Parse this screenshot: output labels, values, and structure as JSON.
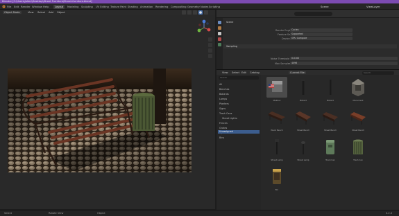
{
  "window": {
    "title": "Blender [C:\\Users\\Julien\\Desktop\\Street Furniture\\Street-furniture.blend]"
  },
  "menu": {
    "items": [
      "File",
      "Edit",
      "Render",
      "Window",
      "Help"
    ],
    "workspaces": [
      "Layout",
      "Modeling",
      "Sculpting",
      "UV Editing",
      "Texture Paint",
      "Shading",
      "Animation",
      "Rendering",
      "Compositing",
      "Geometry Nodes",
      "Scripting"
    ],
    "active_workspace": "Layout",
    "scene_label": "Scene",
    "viewlayer_label": "ViewLayer"
  },
  "viewport_header": {
    "mode": "Object Mode",
    "items": [
      "View",
      "Select",
      "Add",
      "Object"
    ]
  },
  "properties": {
    "section": "Scene",
    "rows": [
      {
        "label": "Render Engine",
        "value": "Cycles"
      },
      {
        "label": "Feature Set",
        "value": "Supported"
      },
      {
        "label": "Device",
        "value": "GPU Compute"
      }
    ],
    "subheader": "Sampling",
    "rows2": [
      {
        "label": "Noise Threshold",
        "value": "0.0100"
      },
      {
        "label": "Max Samples",
        "value": "4096"
      }
    ]
  },
  "asset_browser": {
    "header": [
      "View",
      "Select",
      "Edit",
      "Catalog"
    ],
    "library": "Current File",
    "search_placeholder": "Search",
    "tree": [
      "All",
      "Benches",
      "Bollards",
      "Lamps",
      "Planters",
      "Signs",
      "Trash Cans",
      "Street Lights",
      "Fences",
      "Grates",
      "Hydrants",
      "Bins",
      "Unassigned"
    ],
    "selected_tree_item": "Unassigned",
    "assets": [
      {
        "name": "Mailbox",
        "kind": "mailbox"
      },
      {
        "name": "Bollard",
        "kind": "bollard"
      },
      {
        "name": "Bollard",
        "kind": "bollard"
      },
      {
        "name": "Monument",
        "kind": "monument"
      },
      {
        "name": "Wood Bench",
        "kind": "bench"
      },
      {
        "name": "Street Bench",
        "kind": "bench"
      },
      {
        "name": "Street Bench",
        "kind": "bench"
      },
      {
        "name": "Street Bench",
        "kind": "bench-red"
      },
      {
        "name": "Street Lamp",
        "kind": "lamp"
      },
      {
        "name": "Street Lamp",
        "kind": "lamp-small"
      },
      {
        "name": "Trash Can",
        "kind": "trash-green"
      },
      {
        "name": "Trash Can",
        "kind": "trash-grate"
      },
      {
        "name": "Bin",
        "kind": "bin-yellow"
      }
    ]
  },
  "status": {
    "left": "Select",
    "mid": "Rotate View",
    "right": "Object",
    "version": "3.2.0"
  }
}
